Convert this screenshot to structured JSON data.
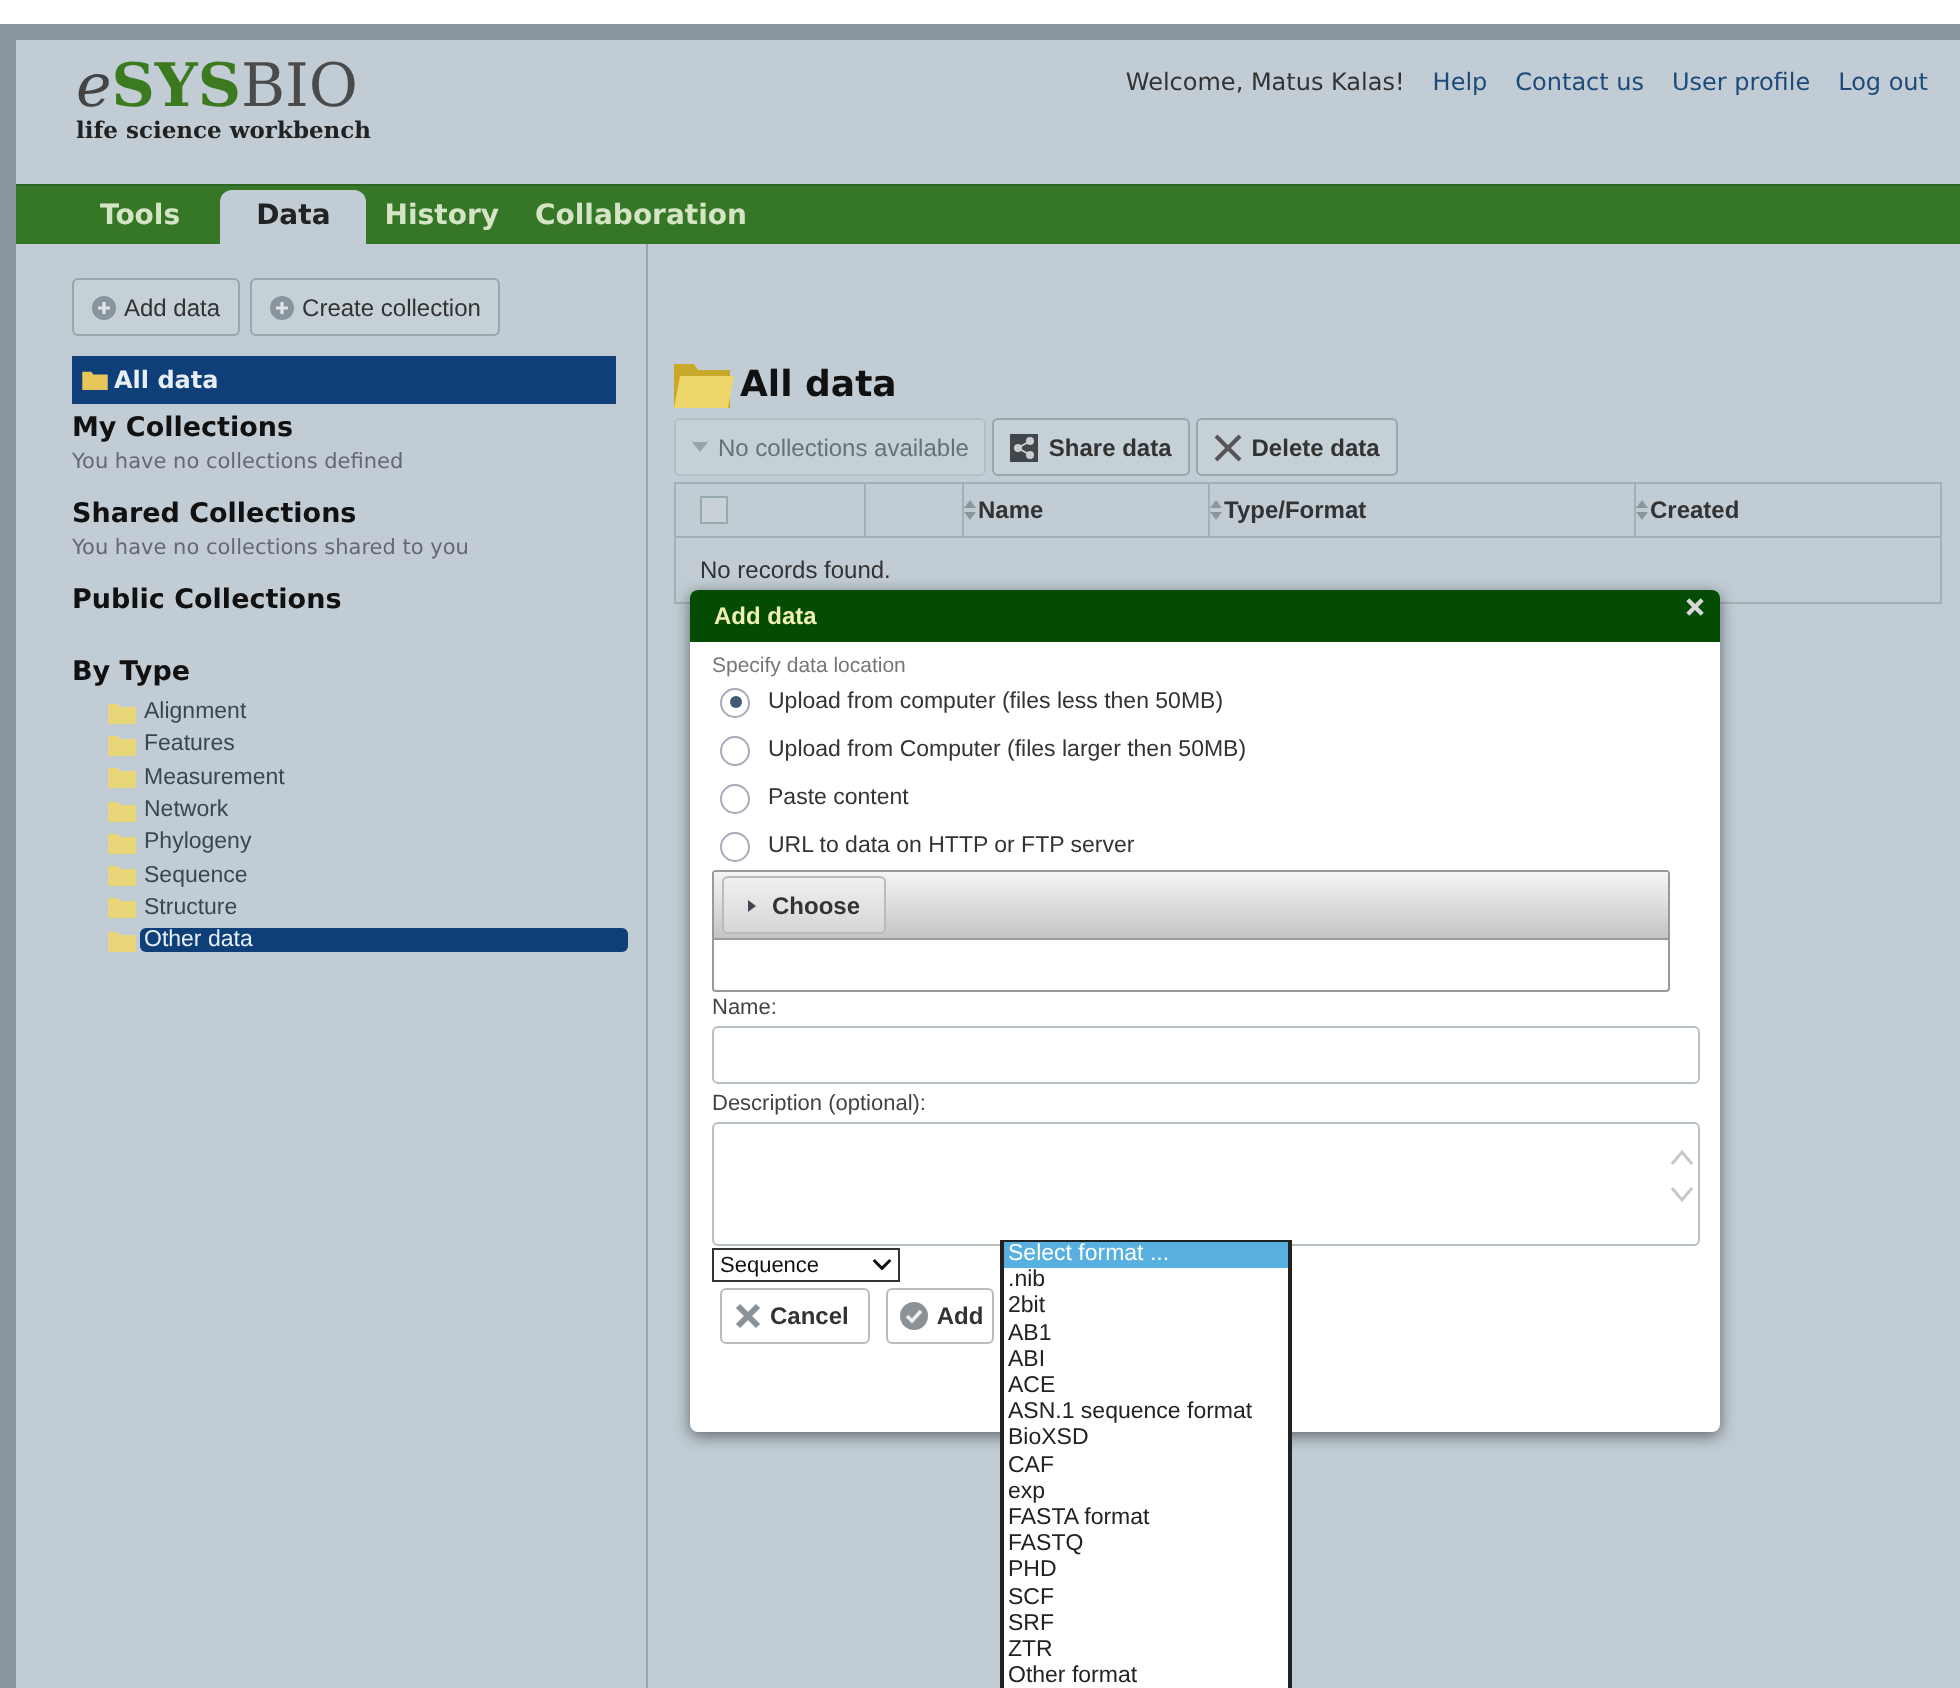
{
  "header": {
    "logo": {
      "prefix": "e",
      "middle": "SYS",
      "suffix": "BIO",
      "tagline": "life science workbench"
    },
    "welcome": "Welcome, Matus Kalas!",
    "links": [
      "Help",
      "Contact us",
      "User profile",
      "Log out"
    ]
  },
  "tabs": [
    {
      "label": "Tools",
      "selected": false
    },
    {
      "label": "Data",
      "selected": true
    },
    {
      "label": "History",
      "selected": false
    },
    {
      "label": "Collaboration",
      "selected": false
    }
  ],
  "sidebar": {
    "buttons": [
      "Add data",
      "Create collection"
    ],
    "all_data": {
      "label": "All data",
      "selected": true
    },
    "sections": [
      {
        "title": "My Collections",
        "note": "You have no collections defined"
      },
      {
        "title": "Shared Collections",
        "note": "You have no collections shared to you"
      },
      {
        "title": "Public Collections"
      }
    ],
    "by_type": {
      "title": "By Type",
      "items": [
        {
          "label": "Alignment",
          "selected": false
        },
        {
          "label": "Features",
          "selected": false
        },
        {
          "label": "Measurement",
          "selected": false
        },
        {
          "label": "Network",
          "selected": false
        },
        {
          "label": "Phylogeny",
          "selected": false
        },
        {
          "label": "Sequence",
          "selected": false
        },
        {
          "label": "Structure",
          "selected": false
        },
        {
          "label": "Other data",
          "selected": true
        }
      ]
    }
  },
  "main": {
    "title": "All data",
    "toolbar": [
      {
        "label": "No collections available",
        "disabled": true,
        "kind": "dropdown"
      },
      {
        "label": "Share data",
        "disabled": false,
        "kind": "share"
      },
      {
        "label": "Delete data",
        "disabled": false,
        "kind": "delete"
      }
    ],
    "table": {
      "select_all_checked": false,
      "columns": [
        "Name",
        "Type/Format",
        "Created"
      ],
      "empty": "No records found."
    }
  },
  "dialog": {
    "title": "Add data",
    "location_label": "Specify data location",
    "options": [
      {
        "label": "Upload from computer (files less then 50MB)",
        "selected": true
      },
      {
        "label": "Upload from Computer (files larger then 50MB)",
        "selected": false
      },
      {
        "label": "Paste content",
        "selected": false
      },
      {
        "label": "URL to data on HTTP or FTP server",
        "selected": false
      }
    ],
    "choose_button": "Choose",
    "name_label": "Name:",
    "description_label": "Description (optional):",
    "type_select": "Sequence",
    "buttons": [
      {
        "label": "Cancel",
        "kind": "cancel"
      },
      {
        "label": "Add",
        "kind": "add"
      }
    ],
    "format_list": [
      {
        "label": "Select format ...",
        "selected": true
      },
      {
        "label": ".nib",
        "selected": false
      },
      {
        "label": "2bit",
        "selected": false
      },
      {
        "label": "AB1",
        "selected": false
      },
      {
        "label": "ABI",
        "selected": false
      },
      {
        "label": "ACE",
        "selected": false
      },
      {
        "label": "ASN.1 sequence format",
        "selected": false
      },
      {
        "label": "BioXSD",
        "selected": false
      },
      {
        "label": "CAF",
        "selected": false
      },
      {
        "label": "exp",
        "selected": false
      },
      {
        "label": "FASTA format",
        "selected": false
      },
      {
        "label": "FASTQ",
        "selected": false
      },
      {
        "label": "PHD",
        "selected": false
      },
      {
        "label": "SCF",
        "selected": false
      },
      {
        "label": "SRF",
        "selected": false
      },
      {
        "label": "ZTR",
        "selected": false
      },
      {
        "label": "Other format",
        "selected": false
      }
    ]
  }
}
